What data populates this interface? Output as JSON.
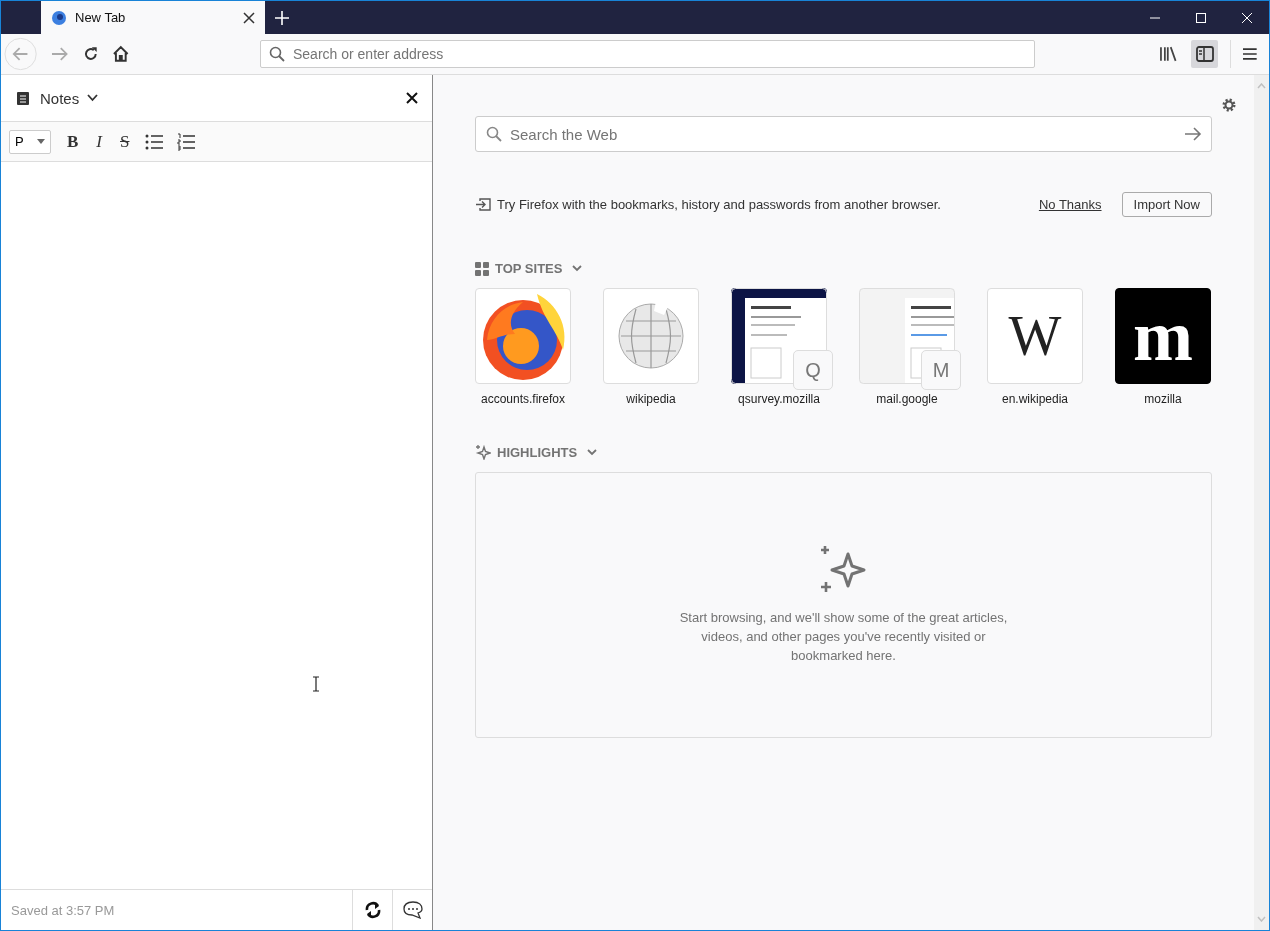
{
  "tabs": [
    {
      "title": "New Tab",
      "selected": true
    }
  ],
  "toolbar": {
    "address_placeholder": "Search or enter address",
    "sidebar_toggle_on": true
  },
  "sidebar": {
    "title": "Notes",
    "format": "P",
    "format_buttons": [
      {
        "label": "B",
        "kind": "bold"
      },
      {
        "label": "I",
        "kind": "italic"
      },
      {
        "label": "S",
        "kind": "strike"
      }
    ],
    "status": "Saved at 3:57 PM"
  },
  "newtab": {
    "search_placeholder": "Search the Web",
    "import": {
      "message": "Try Firefox with the bookmarks, history and passwords from another browser.",
      "dismiss": "No Thanks",
      "action": "Import Now"
    },
    "top_sites": {
      "title": "TOP SITES",
      "expanded": true,
      "sites": [
        {
          "label": "accounts.firefox",
          "kind": "firefox"
        },
        {
          "label": "wikipedia",
          "kind": "globe"
        },
        {
          "label": "qsurvey.mozilla",
          "kind": "screenshot",
          "badge": "Q",
          "dark": true
        },
        {
          "label": "mail.google",
          "kind": "screenshot",
          "badge": "M",
          "dark": false
        },
        {
          "label": "en.wikipedia",
          "kind": "letter",
          "letter": "W",
          "inverted": false
        },
        {
          "label": "mozilla",
          "kind": "letter",
          "letter": "m",
          "inverted": true
        }
      ]
    },
    "highlights": {
      "title": "HIGHLIGHTS",
      "expanded": true,
      "empty_message": "Start browsing, and we'll show some of the great articles, videos, and other pages you've recently visited or bookmarked here."
    }
  }
}
